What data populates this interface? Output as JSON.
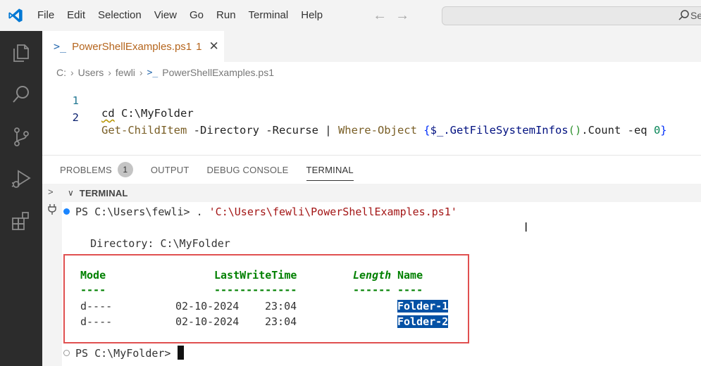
{
  "menu": [
    "File",
    "Edit",
    "Selection",
    "View",
    "Go",
    "Run",
    "Terminal",
    "Help"
  ],
  "search": {
    "text": "Se"
  },
  "tab": {
    "label": "PowerShellExamples.ps1",
    "problem_count": "1"
  },
  "breadcrumb": [
    "C:",
    "Users",
    "fewli",
    "PowerShellExamples.ps1"
  ],
  "code": {
    "line1_no": "1",
    "line2_no": "2",
    "line1_cmd": "cd",
    "line1_arg": " C:\\MyFolder",
    "line2_cmd": "Get-ChildItem",
    "line2_params": " -Directory -Recurse | ",
    "line2_where": "Where-Object",
    "line2_sp": " ",
    "line2_brace_open": "{",
    "line2_var": "$_",
    "line2_member": ".GetFileSystemInfos",
    "line2_parens": "()",
    "line2_rest": ".Count -eq ",
    "line2_num": "0",
    "line2_brace_close": "}"
  },
  "panel": {
    "tabs": [
      "PROBLEMS",
      "OUTPUT",
      "DEBUG CONSOLE",
      "TERMINAL"
    ],
    "problems_badge": "1",
    "terminal_title": "TERMINAL"
  },
  "terminal": {
    "prompt1": "PS C:\\Users\\fewli> . ",
    "script_path": "'C:\\Users\\fewli\\PowerShellExamples.ps1'",
    "directory_line": "    Directory: C:\\MyFolder",
    "headers": {
      "mode": "Mode",
      "lastwrite": "LastWriteTime",
      "length": "Length",
      "name": "Name"
    },
    "underline": {
      "mode": "----",
      "lastwrite": "-------------",
      "length": "------",
      "name": "----"
    },
    "rows": [
      {
        "mode": "d----",
        "date": "02-10-2024",
        "time": "23:04",
        "name": "Folder-1"
      },
      {
        "mode": "d----",
        "date": "02-10-2024",
        "time": "23:04",
        "name": "Folder-2"
      }
    ],
    "prompt2": "PS C:\\MyFolder> "
  }
}
